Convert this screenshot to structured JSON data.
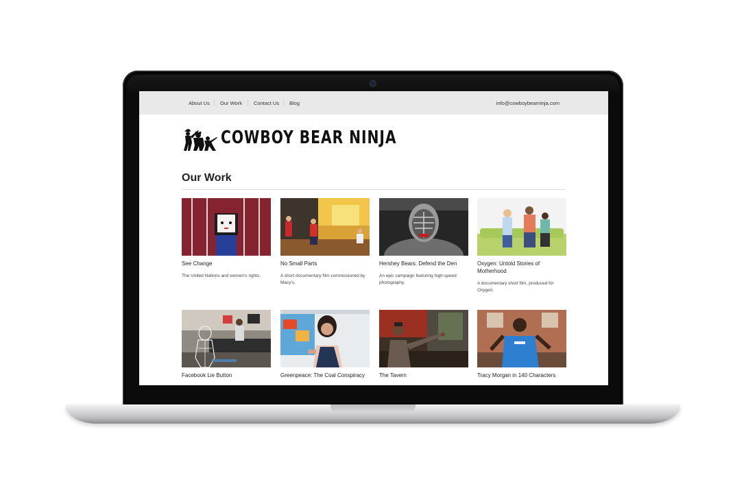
{
  "nav": {
    "items": [
      {
        "label": "About Us"
      },
      {
        "label": "Our Work"
      },
      {
        "label": "Contact Us"
      },
      {
        "label": "Blog"
      }
    ],
    "email": "info@cowboybearninja.com"
  },
  "brand": {
    "name": "COWBOY BEAR NINJA",
    "logo_icon": "ninja-silhouettes-icon"
  },
  "page": {
    "title": "Our Work"
  },
  "work": [
    {
      "title": "See Change",
      "description": "The United Nations and women's rights.",
      "thumb": "puppet-in-red-room"
    },
    {
      "title": "No Small Parts",
      "description": "A short documentary film commissioned by Macy's.",
      "thumb": "kids-on-stage"
    },
    {
      "title": "Hershey Bears: Defend the Den",
      "description": "An epic campaign featuring high-speed photography.",
      "thumb": "hockey-goalie-mask"
    },
    {
      "title": "Oxygen: Untold Stories of Motherhood",
      "description": "A documentary short film, produced for Oxygen.",
      "thumb": "family-on-green-couch"
    },
    {
      "title": "Facebook Lie Button",
      "description": "",
      "thumb": "wireframe-figure-living-room"
    },
    {
      "title": "Greenpeace: The Coal Conspiracy",
      "description": "",
      "thumb": "woman-presenting-map"
    },
    {
      "title": "The Tavern",
      "description": "",
      "thumb": "man-at-bar"
    },
    {
      "title": "Tracy Morgan in 140 Characters",
      "description": "",
      "thumb": "man-in-blue-shirt"
    }
  ],
  "colors": {
    "topbar": "#e9e9e9",
    "bezel": "#0b0b0b",
    "text": "#222222"
  }
}
